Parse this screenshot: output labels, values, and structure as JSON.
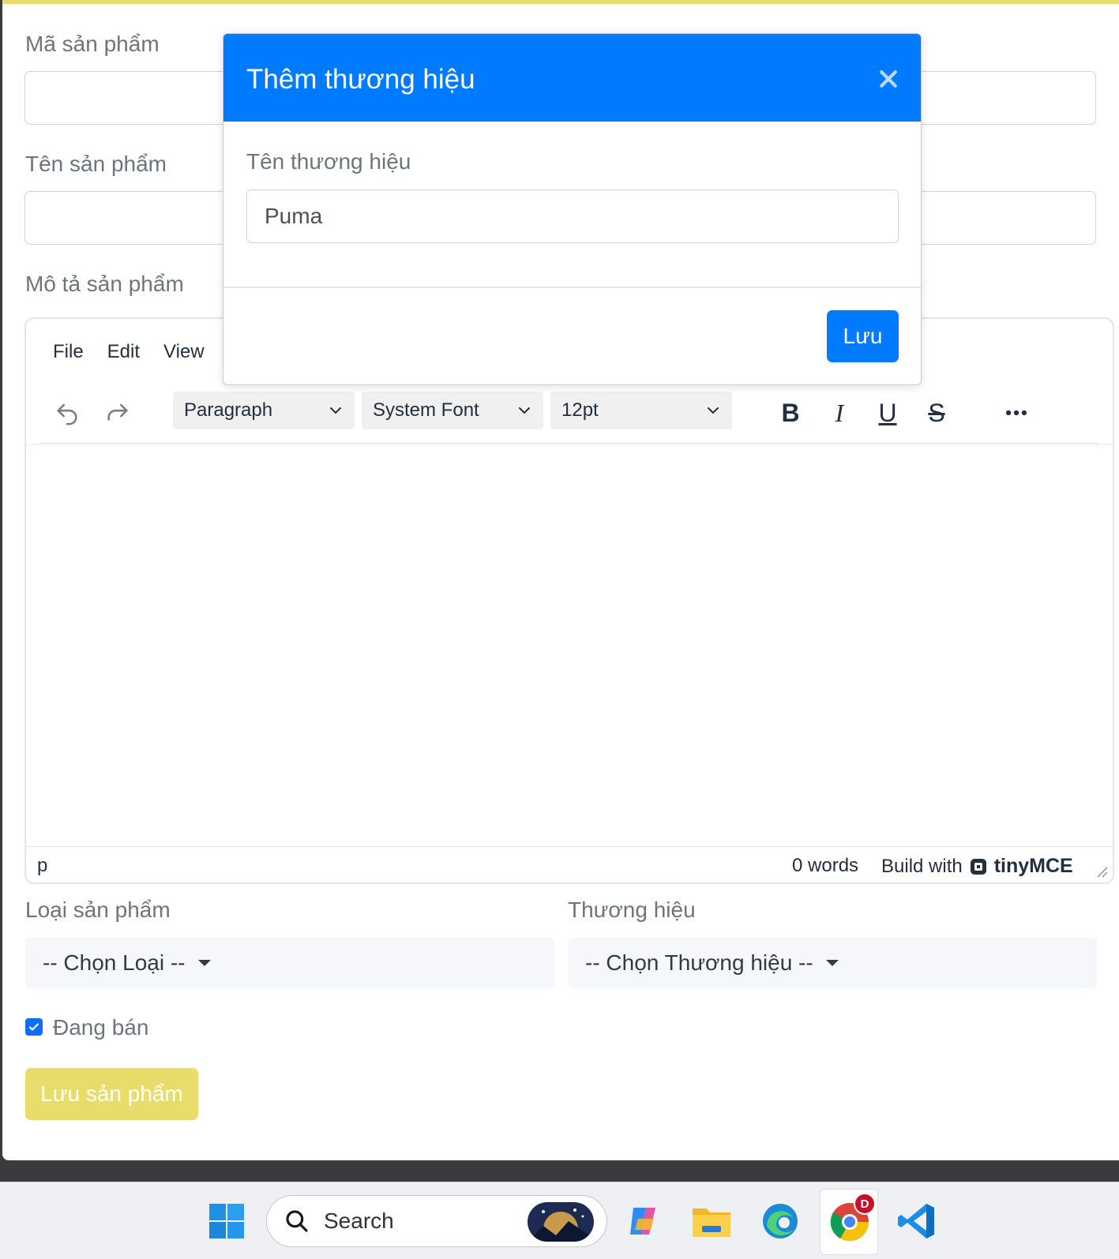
{
  "form": {
    "code_label": "Mã sản phẩm",
    "name_label": "Tên sản phẩm",
    "description_label": "Mô tả sản phẩm",
    "category_label": "Loại sản phẩm",
    "category_selected": "-- Chọn Loại --",
    "brand_label": "Thương hiệu",
    "brand_selected": "-- Chọn Thương hiệu --",
    "on_sale_label": "Đang bán",
    "on_sale_checked": true,
    "save_product_label": "Lưu sản phẩm"
  },
  "editor": {
    "menu": [
      "File",
      "Edit",
      "View"
    ],
    "block_format": "Paragraph",
    "font_family": "System Font",
    "font_size": "12pt",
    "bold": "B",
    "italic": "I",
    "underline": "U",
    "strike": "S",
    "path": "p",
    "word_count": "0 words",
    "build_with": "Build with",
    "brand": "tinyMCE"
  },
  "modal": {
    "title": "Thêm thương hiệu",
    "field_label": "Tên thương hiệu",
    "field_value": "Puma",
    "save_label": "Lưu"
  },
  "taskbar": {
    "search_label": "Search",
    "chrome_badge": "D"
  },
  "colors": {
    "primary": "#007bff",
    "accent_yellow": "#e8dc6a",
    "muted_text": "#6c757d"
  }
}
